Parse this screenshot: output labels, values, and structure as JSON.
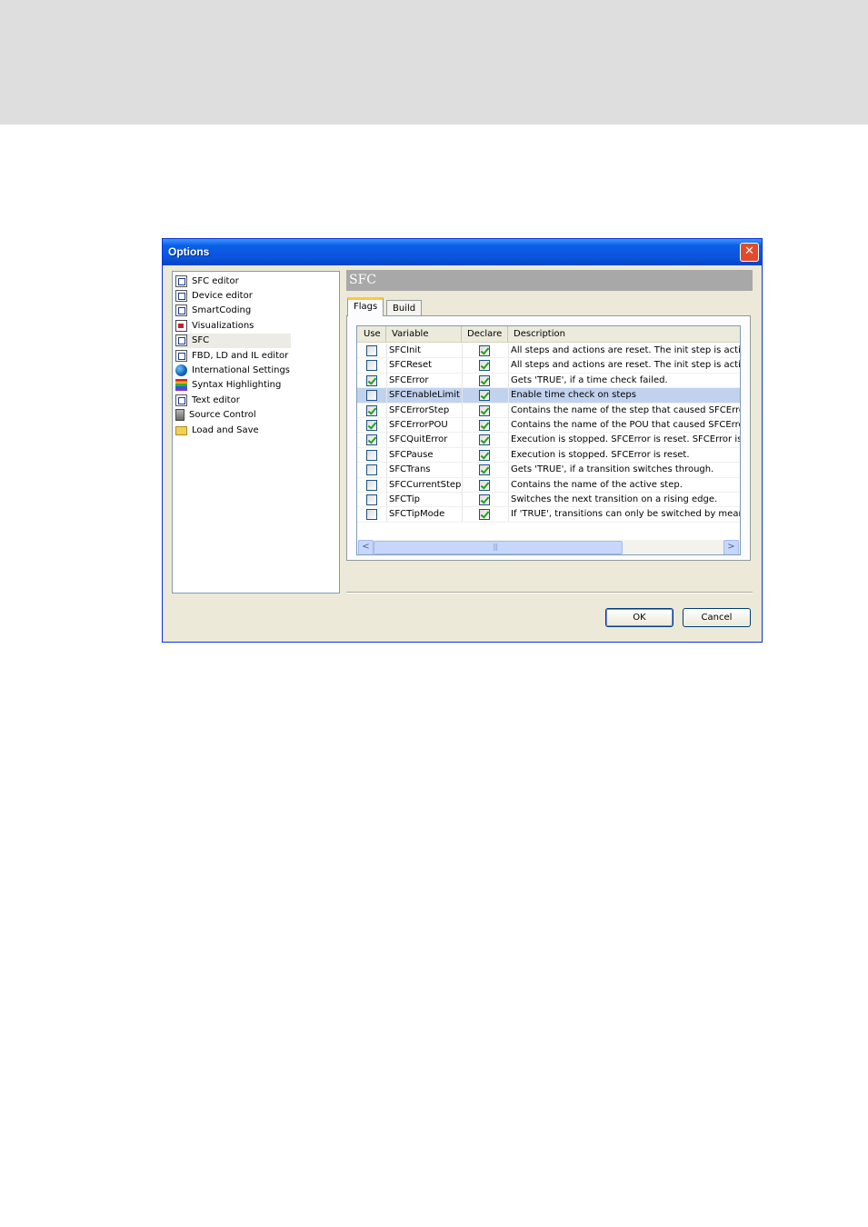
{
  "dialog": {
    "title": "Options",
    "close_glyph": "✕"
  },
  "tree": {
    "items": [
      {
        "label": "SFC editor",
        "icon": "document-icon"
      },
      {
        "label": "Device editor",
        "icon": "device-icon"
      },
      {
        "label": "SmartCoding",
        "icon": "smartcoding-icon"
      },
      {
        "label": "Visualizations",
        "icon": "visualization-icon"
      },
      {
        "label": "SFC",
        "icon": "sfc-icon"
      },
      {
        "label": "FBD, LD and IL editor",
        "icon": "editor-icon"
      },
      {
        "label": "International Settings",
        "icon": "globe-icon"
      },
      {
        "label": "Syntax Highlighting",
        "icon": "rainbow-icon"
      },
      {
        "label": "Text editor",
        "icon": "text-document-icon"
      },
      {
        "label": "Source Control",
        "icon": "server-icon"
      },
      {
        "label": "Load and Save",
        "icon": "folder-icon"
      }
    ],
    "selected_index": 4
  },
  "section": {
    "title": "SFC"
  },
  "tabs": [
    {
      "label": "Flags"
    },
    {
      "label": "Build"
    }
  ],
  "grid": {
    "columns": [
      "Use",
      "Variable",
      "Declare",
      "Description"
    ],
    "rows": [
      {
        "use": false,
        "variable": "SFCInit",
        "declare": true,
        "description": "All steps and actions are reset. The init step is activate"
      },
      {
        "use": false,
        "variable": "SFCReset",
        "declare": true,
        "description": "All steps and actions are reset. The init step is activate"
      },
      {
        "use": true,
        "variable": "SFCError",
        "declare": true,
        "description": "Gets 'TRUE', if a time check failed."
      },
      {
        "use": false,
        "variable": "SFCEnableLimit",
        "declare": true,
        "description": "Enable time check on steps"
      },
      {
        "use": true,
        "variable": "SFCErrorStep",
        "declare": true,
        "description": "Contains the name of the step that caused SFCError to"
      },
      {
        "use": true,
        "variable": "SFCErrorPOU",
        "declare": true,
        "description": "Contains the name of the POU that caused SFCError to"
      },
      {
        "use": true,
        "variable": "SFCQuitError",
        "declare": true,
        "description": "Execution is stopped. SFCError is reset. SFCError is rec"
      },
      {
        "use": false,
        "variable": "SFCPause",
        "declare": true,
        "description": "Execution is stopped. SFCError is reset."
      },
      {
        "use": false,
        "variable": "SFCTrans",
        "declare": true,
        "description": "Gets 'TRUE', if a transition switches through."
      },
      {
        "use": false,
        "variable": "SFCCurrentStep",
        "declare": true,
        "description": "Contains the name of the active step."
      },
      {
        "use": false,
        "variable": "SFCTip",
        "declare": true,
        "description": "Switches the next transition on a rising edge."
      },
      {
        "use": false,
        "variable": "SFCTipMode",
        "declare": true,
        "description": "If 'TRUE', transitions can only be switched by means of"
      }
    ],
    "selected_index": 3
  },
  "scrollbar": {
    "left_glyph": "<",
    "right_glyph": ">"
  },
  "buttons": {
    "ok": "OK",
    "cancel": "Cancel"
  },
  "colors": {
    "titlebar": "#0a54de",
    "selection": "#c1d2ee",
    "section_header": "#a8a8a8"
  }
}
